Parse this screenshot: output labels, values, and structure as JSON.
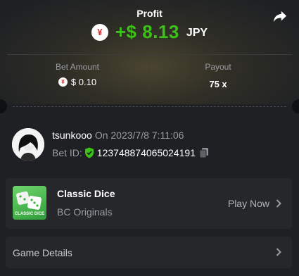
{
  "profit": {
    "title": "Profit",
    "value": "+$ 8.13",
    "currency": "JPY",
    "currency_symbol": "¥",
    "value_color": "#3bc117"
  },
  "stats": {
    "bet_amount_label": "Bet Amount",
    "bet_amount_value": "$ 0.10",
    "payout_label": "Payout",
    "payout_value": "75 x"
  },
  "user": {
    "name": "tsunkooo",
    "date_text": "On 2023/7/8 7:11:06",
    "bet_id_label": "Bet ID:",
    "bet_id": "123748874065024191"
  },
  "game": {
    "name": "Classic Dice",
    "provider": "BC Originals",
    "thumb_text": "CLASSIC DICE",
    "play_label": "Play Now"
  },
  "details": {
    "label": "Game Details"
  },
  "icons": {
    "share": "share-icon",
    "shield": "verified-shield-icon",
    "copy": "copy-icon",
    "chevron": "chevron-right-icon"
  },
  "colors": {
    "background": "#1e2024",
    "card": "#25272b",
    "accent_green": "#3bc117",
    "muted_text": "#9a9ca1"
  }
}
